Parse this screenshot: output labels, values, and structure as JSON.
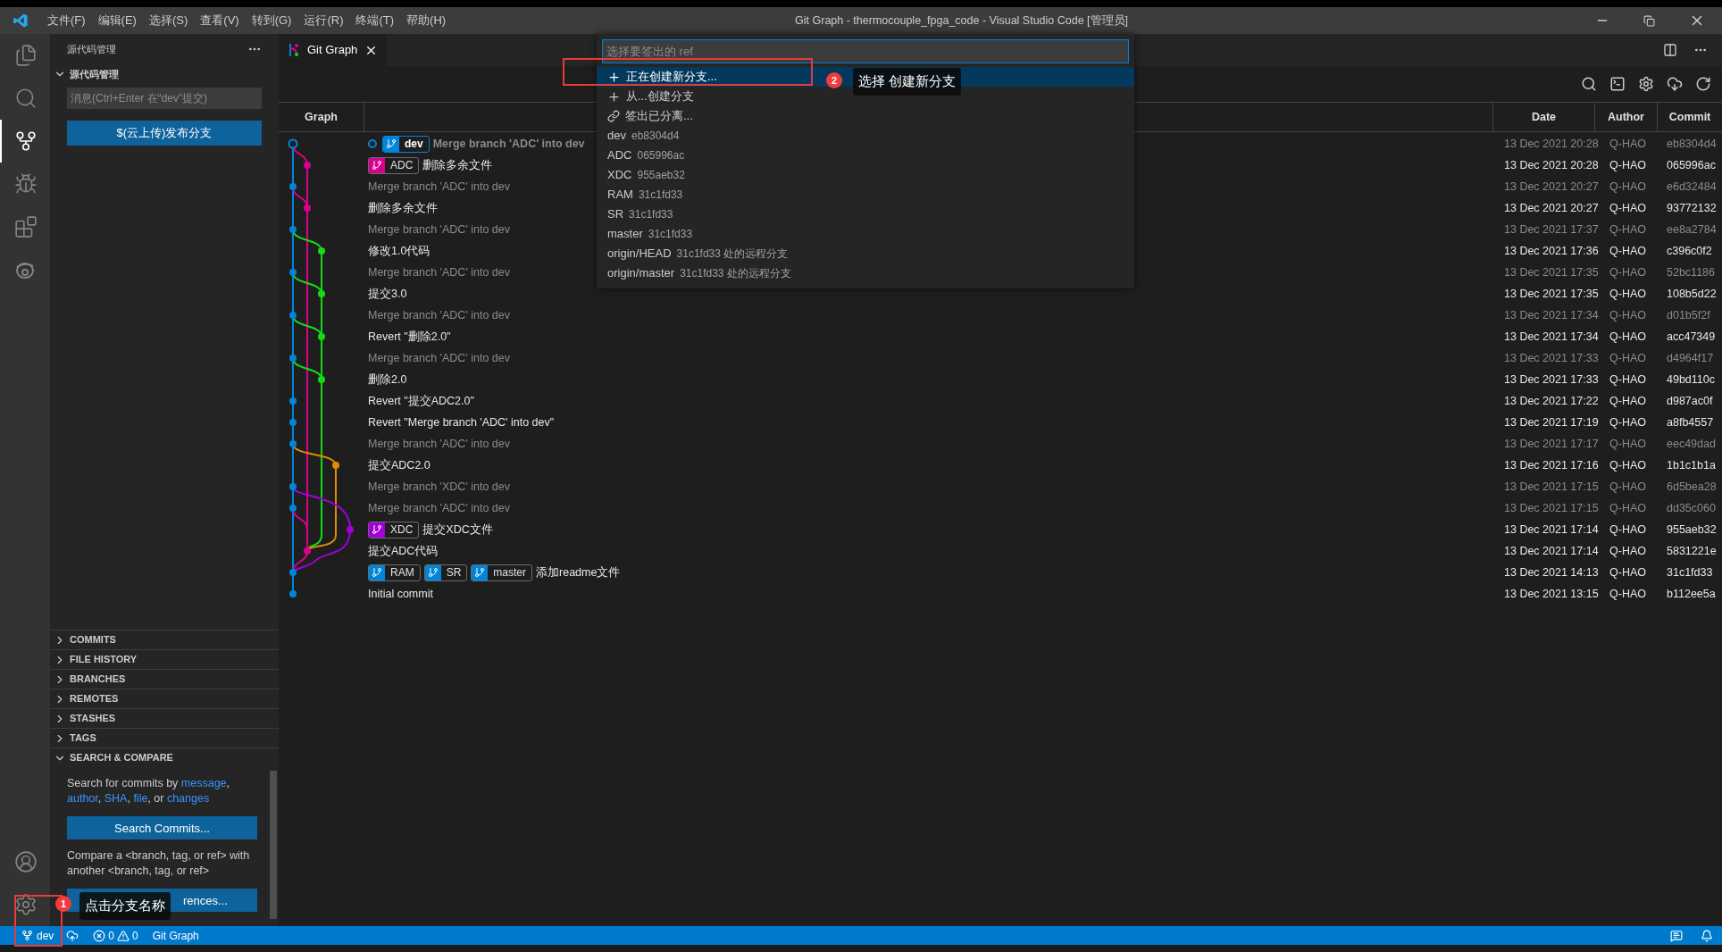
{
  "window": {
    "title": "Git Graph - thermocouple_fpga_code - Visual Studio Code [管理员]"
  },
  "menu": [
    "文件(F)",
    "编辑(E)",
    "选择(S)",
    "查看(V)",
    "转到(G)",
    "运行(R)",
    "终端(T)",
    "帮助(H)"
  ],
  "sidebar": {
    "title": "源代码管理",
    "section": {
      "title": "源代码管理",
      "expanded": true
    },
    "message_placeholder": "消息(Ctrl+Enter 在“dev”提交)",
    "publish_button": "$(云上传)发布分支",
    "panels": [
      {
        "title": "COMMITS",
        "expanded": false
      },
      {
        "title": "FILE HISTORY",
        "expanded": false
      },
      {
        "title": "BRANCHES",
        "expanded": false
      },
      {
        "title": "REMOTES",
        "expanded": false
      },
      {
        "title": "STASHES",
        "expanded": false
      },
      {
        "title": "TAGS",
        "expanded": false
      },
      {
        "title": "SEARCH & COMPARE",
        "expanded": true
      }
    ],
    "search_text": [
      {
        "text": "Search for commits by ",
        "link": false
      },
      {
        "text": "message",
        "link": true
      },
      {
        "text": ", ",
        "link": false
      },
      {
        "text": "author",
        "link": true
      },
      {
        "text": ", ",
        "link": false
      },
      {
        "text": "SHA",
        "link": true
      },
      {
        "text": ", ",
        "link": false
      },
      {
        "text": "file",
        "link": true
      },
      {
        "text": ", or ",
        "link": false
      },
      {
        "text": "changes",
        "link": true
      }
    ],
    "search_button": "Search Commits...",
    "compare_text": "Compare a <branch, tag, or ref> with another <branch, tag, or ref>",
    "compare_button": "rences..."
  },
  "tab": {
    "title": "Git Graph"
  },
  "table": {
    "graph_heading": "Graph",
    "columns": [
      "Date",
      "Author",
      "Commit"
    ],
    "rows": [
      {
        "message": "Merge branch 'ADC' into dev",
        "head": true,
        "dimmed": true,
        "refs": [
          {
            "name": "dev",
            "color": "#0085d9",
            "checked_out": true
          }
        ],
        "date": "13 Dec 2021 20:28",
        "author": "Q-HAO",
        "commit": "eb8304d4"
      },
      {
        "message": "删除多余文件",
        "head": false,
        "dimmed": false,
        "refs": [
          {
            "name": "ADC",
            "color": "#d9008f",
            "checked_out": false
          }
        ],
        "date": "13 Dec 2021 20:28",
        "author": "Q-HAO",
        "commit": "065996ac"
      },
      {
        "message": "Merge branch 'ADC' into dev",
        "head": false,
        "dimmed": true,
        "date": "13 Dec 2021 20:27",
        "author": "Q-HAO",
        "commit": "e6d32484"
      },
      {
        "message": "删除多余文件",
        "head": false,
        "dimmed": false,
        "date": "13 Dec 2021 20:27",
        "author": "Q-HAO",
        "commit": "93772132"
      },
      {
        "message": "Merge branch 'ADC' into dev",
        "head": false,
        "dimmed": true,
        "date": "13 Dec 2021 17:37",
        "author": "Q-HAO",
        "commit": "ee8a2784"
      },
      {
        "message": "修改1.0代码",
        "head": false,
        "dimmed": false,
        "date": "13 Dec 2021 17:36",
        "author": "Q-HAO",
        "commit": "c396c0f2"
      },
      {
        "message": "Merge branch 'ADC' into dev",
        "head": false,
        "dimmed": true,
        "date": "13 Dec 2021 17:35",
        "author": "Q-HAO",
        "commit": "52bc1186"
      },
      {
        "message": "提交3.0",
        "head": false,
        "dimmed": false,
        "date": "13 Dec 2021 17:35",
        "author": "Q-HAO",
        "commit": "108b5d22"
      },
      {
        "message": "Merge branch 'ADC' into dev",
        "head": false,
        "dimmed": true,
        "date": "13 Dec 2021 17:34",
        "author": "Q-HAO",
        "commit": "d01b5f2f"
      },
      {
        "message": "Revert \"删除2.0\"",
        "head": false,
        "dimmed": false,
        "date": "13 Dec 2021 17:34",
        "author": "Q-HAO",
        "commit": "acc47349"
      },
      {
        "message": "Merge branch 'ADC' into dev",
        "head": false,
        "dimmed": true,
        "date": "13 Dec 2021 17:33",
        "author": "Q-HAO",
        "commit": "d4964f17"
      },
      {
        "message": "删除2.0",
        "head": false,
        "dimmed": false,
        "date": "13 Dec 2021 17:33",
        "author": "Q-HAO",
        "commit": "49bd110c"
      },
      {
        "message": "Revert \"提交ADC2.0\"",
        "head": false,
        "dimmed": false,
        "date": "13 Dec 2021 17:22",
        "author": "Q-HAO",
        "commit": "d987ac0f"
      },
      {
        "message": "Revert \"Merge branch 'ADC' into dev\"",
        "head": false,
        "dimmed": false,
        "date": "13 Dec 2021 17:19",
        "author": "Q-HAO",
        "commit": "a8fb4557"
      },
      {
        "message": "Merge branch 'ADC' into dev",
        "head": false,
        "dimmed": true,
        "date": "13 Dec 2021 17:17",
        "author": "Q-HAO",
        "commit": "eec49dad"
      },
      {
        "message": "提交ADC2.0",
        "head": false,
        "dimmed": false,
        "date": "13 Dec 2021 17:16",
        "author": "Q-HAO",
        "commit": "1b1c1b1a"
      },
      {
        "message": "Merge branch 'XDC' into dev",
        "head": false,
        "dimmed": true,
        "date": "13 Dec 2021 17:15",
        "author": "Q-HAO",
        "commit": "6d5bea28"
      },
      {
        "message": "Merge branch 'ADC' into dev",
        "head": false,
        "dimmed": true,
        "date": "13 Dec 2021 17:15",
        "author": "Q-HAO",
        "commit": "dd35c060"
      },
      {
        "message": "提交XDC文件",
        "head": false,
        "dimmed": false,
        "refs": [
          {
            "name": "XDC",
            "color": "#a300d9",
            "checked_out": false
          }
        ],
        "date": "13 Dec 2021 17:14",
        "author": "Q-HAO",
        "commit": "955aeb32"
      },
      {
        "message": "提交ADC代码",
        "head": false,
        "dimmed": false,
        "date": "13 Dec 2021 17:14",
        "author": "Q-HAO",
        "commit": "5831221e"
      },
      {
        "message": "添加readme文件",
        "head": false,
        "dimmed": false,
        "refs": [
          {
            "name": "RAM",
            "color": "#0085d9",
            "checked_out": false
          },
          {
            "name": "SR",
            "color": "#0085d9",
            "checked_out": false
          },
          {
            "name": "master",
            "color": "#0085d9",
            "checked_out": false
          }
        ],
        "date": "13 Dec 2021 14:13",
        "author": "Q-HAO",
        "commit": "31c1fd33"
      },
      {
        "message": "Initial commit",
        "head": false,
        "dimmed": false,
        "date": "13 Dec 2021 13:15",
        "author": "Q-HAO",
        "commit": "b112ee5a"
      }
    ]
  },
  "quick_pick": {
    "placeholder": "选择要签出的 ref",
    "items": [
      {
        "kind": "create",
        "label": "正在创建新分支...",
        "selected": true
      },
      {
        "kind": "create",
        "label": "从...创建分支",
        "selected": false
      },
      {
        "kind": "detached",
        "label": "签出已分离...",
        "selected": false
      },
      {
        "kind": "ref",
        "label": "dev",
        "detail": "eb8304d4",
        "selected": false
      },
      {
        "kind": "ref",
        "label": "ADC",
        "detail": "065996ac",
        "selected": false
      },
      {
        "kind": "ref",
        "label": "XDC",
        "detail": "955aeb32",
        "selected": false
      },
      {
        "kind": "ref",
        "label": "RAM",
        "detail": "31c1fd33",
        "selected": false
      },
      {
        "kind": "ref",
        "label": "SR",
        "detail": "31c1fd33",
        "selected": false
      },
      {
        "kind": "ref",
        "label": "master",
        "detail": "31c1fd33",
        "selected": false
      },
      {
        "kind": "ref",
        "label": "origin/HEAD",
        "detail": "31c1fd33 处的远程分支",
        "selected": false
      },
      {
        "kind": "ref",
        "label": "origin/master",
        "detail": "31c1fd33 处的远程分支",
        "selected": false
      }
    ]
  },
  "annotations": [
    {
      "number": "1",
      "text": "点击分支名称"
    },
    {
      "number": "2",
      "text": "选择 创建新分支"
    }
  ],
  "status_bar": {
    "branch": "dev",
    "errors": "0",
    "warnings": "0",
    "extension": "Git Graph"
  }
}
